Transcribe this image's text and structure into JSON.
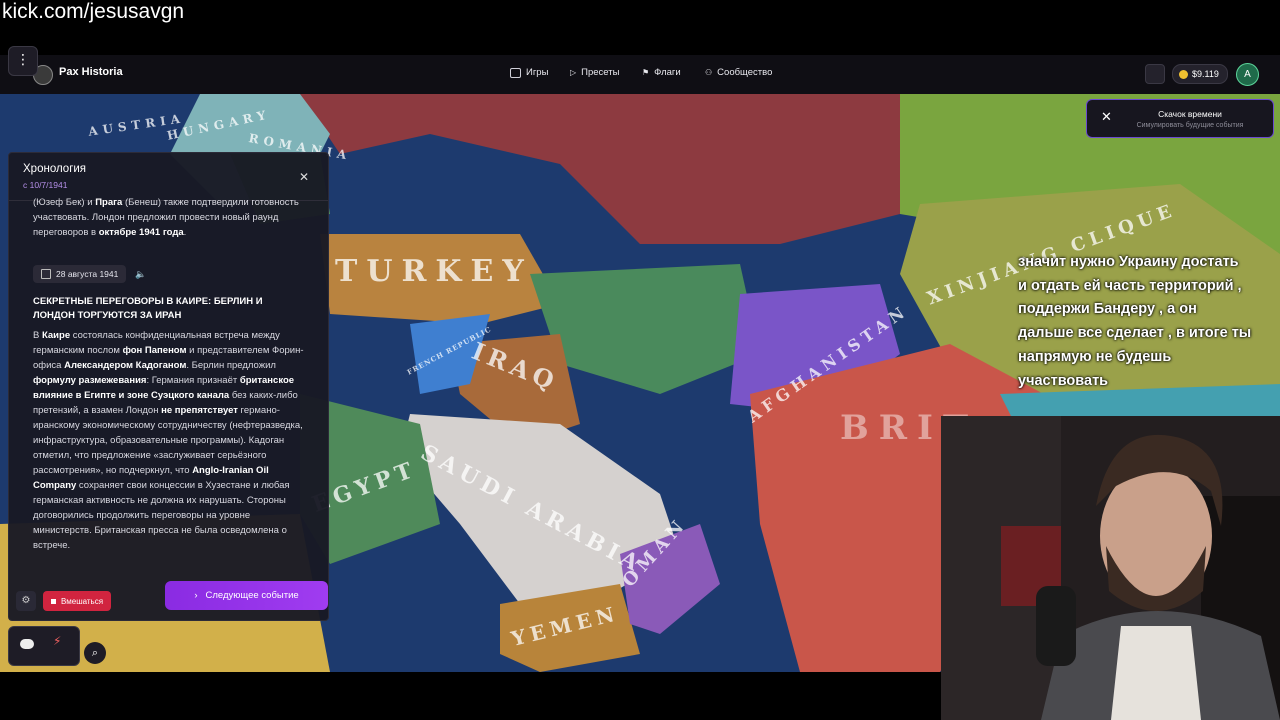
{
  "stream": {
    "watermark": "kick.com/jesusavgn"
  },
  "header": {
    "brand": "Pax Historia",
    "nav": [
      {
        "label": "Игры",
        "icon": "gamepad-icon"
      },
      {
        "label": "Пресеты",
        "icon": "play-icon"
      },
      {
        "label": "Флаги",
        "icon": "flag-icon"
      },
      {
        "label": "Сообщество",
        "icon": "users-icon"
      }
    ],
    "balance": "$9.119",
    "avatar_letter": "A"
  },
  "map": {
    "labels": [
      "HUNGARY",
      "AUSTRIA",
      "ROMANIA",
      "TURKEY",
      "IRAQ",
      "SAUDI ARABIA",
      "AFGHANISTAN",
      "XINJIANG CLIQUE",
      "YEMEN",
      "OMAN",
      "FRENCH REPUBLIC",
      "BRIT",
      "EGYPT"
    ]
  },
  "timeline": {
    "title": "Хронология",
    "subtitle": "с 10/7/1941",
    "prev_paragraph": [
      {
        "t": "(Юзеф Бек) и ",
        "b": false
      },
      {
        "t": "Прага",
        "b": true
      },
      {
        "t": " (Бенеш) также подтвердили готовность участвовать. Лондон предложил провести новый раунд переговоров в ",
        "b": false
      },
      {
        "t": "октябре 1941 года",
        "b": true
      },
      {
        "t": ".",
        "b": false
      }
    ],
    "event": {
      "date": "28 августа 1941",
      "headline": "СЕКРЕТНЫЕ ПЕРЕГОВОРЫ В КАИРЕ: БЕРЛИН И ЛОНДОН ТОРГУЮТСЯ ЗА ИРАН",
      "body": [
        {
          "t": "В ",
          "b": false
        },
        {
          "t": "Каире",
          "b": true
        },
        {
          "t": " состоялась конфиденциальная встреча между германским послом ",
          "b": false
        },
        {
          "t": "фон Папеном",
          "b": true
        },
        {
          "t": " и представителем Форин-офиса ",
          "b": false
        },
        {
          "t": "Александером Кадоганом",
          "b": true
        },
        {
          "t": ". Берлин предложил ",
          "b": false
        },
        {
          "t": "формулу разме­жевания",
          "b": true
        },
        {
          "t": ": Германия признаёт ",
          "b": false
        },
        {
          "t": "британское влияние в Египте и зоне Суэцкого канала",
          "b": true
        },
        {
          "t": " без каких-либо претензий, а взамен Лондон ",
          "b": false
        },
        {
          "t": "не препятствует",
          "b": true
        },
        {
          "t": " германо-иранскому экономическому сотрудничеству (нефтеразведка, инфраструктура, образовательные программы). Кадоган отметил, что предложение «заслуживает серьёзного рассмотрения», но подчеркнул, что ",
          "b": false
        },
        {
          "t": "Anglo-Iranian Oil Company",
          "b": true
        },
        {
          "t": " сохраняет свои концессии в Хузестане и любая германская активность не должна их нарушать. Стороны договорились продолжить переговоры на уровне министерств. Британская пресса не была осведомлена о встрече.",
          "b": false
        }
      ]
    },
    "intervene_label": "Вмешаться",
    "next_event_label": "Следующее событие"
  },
  "toast": {
    "title": "Скачок времени",
    "subtitle": "Симулировать будущие события"
  },
  "subtitles": [
    "значит нужно Украину достать",
    "и отдать ей часть территорий ,",
    "поддержи Бандеру , а он",
    "дальше все сделает , в итоге ты",
    "напрямую не будешь",
    "участвовать"
  ],
  "colors": {
    "accent": "#9b35ec",
    "danger": "#d1243f",
    "date": "#b48fe8",
    "water": "#1d3a6e"
  }
}
